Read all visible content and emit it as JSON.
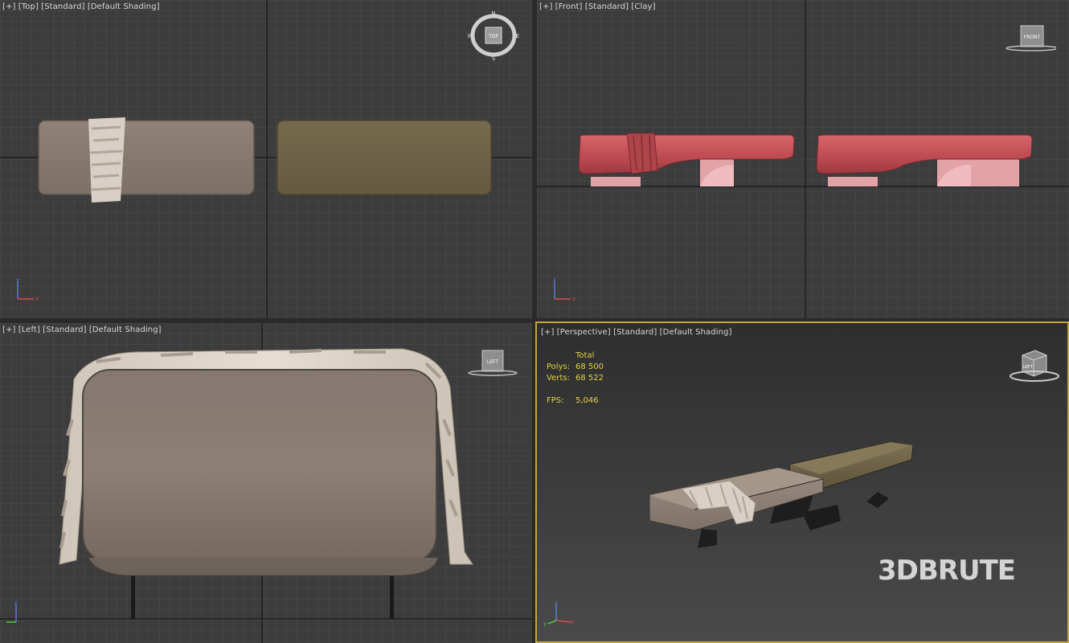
{
  "viewports": {
    "top": {
      "label": [
        "[+]",
        "[Top]",
        "[Standard]",
        "[Default Shading]"
      ],
      "cube_label": "TOP",
      "compass": [
        "N",
        "S",
        "E",
        "W"
      ]
    },
    "front": {
      "label": [
        "[+]",
        "[Front]",
        "[Standard]",
        "[Clay]"
      ],
      "cube_label": "FRONT"
    },
    "left": {
      "label": [
        "[+]",
        "[Left]",
        "[Standard]",
        "[Default Shading]"
      ],
      "cube_label": "LEFT"
    },
    "perspective": {
      "label": [
        "[+]",
        "[Perspective]",
        "[Standard]",
        "[Default Shading]"
      ],
      "cube_label": "LEFT",
      "stats": {
        "header": "Total",
        "polys_label": "Polys:",
        "polys": "68 500",
        "verts_label": "Verts:",
        "verts": "68 522",
        "fps_label": "FPS:",
        "fps": "5,046"
      },
      "watermark": "3DBRUTE"
    }
  },
  "axis_labels": {
    "x": "x",
    "y": "y",
    "z": "z"
  },
  "colors": {
    "viewport_bg": "#3c3c3c",
    "grid_minor": "#4b4b4b",
    "grid_major": "#202020",
    "active_border": "#c6a43a",
    "stats_text": "#e3d04a",
    "fabric_taupe": "#8a7c71",
    "fabric_olive": "#6e6248",
    "clay": "#c8545a"
  }
}
